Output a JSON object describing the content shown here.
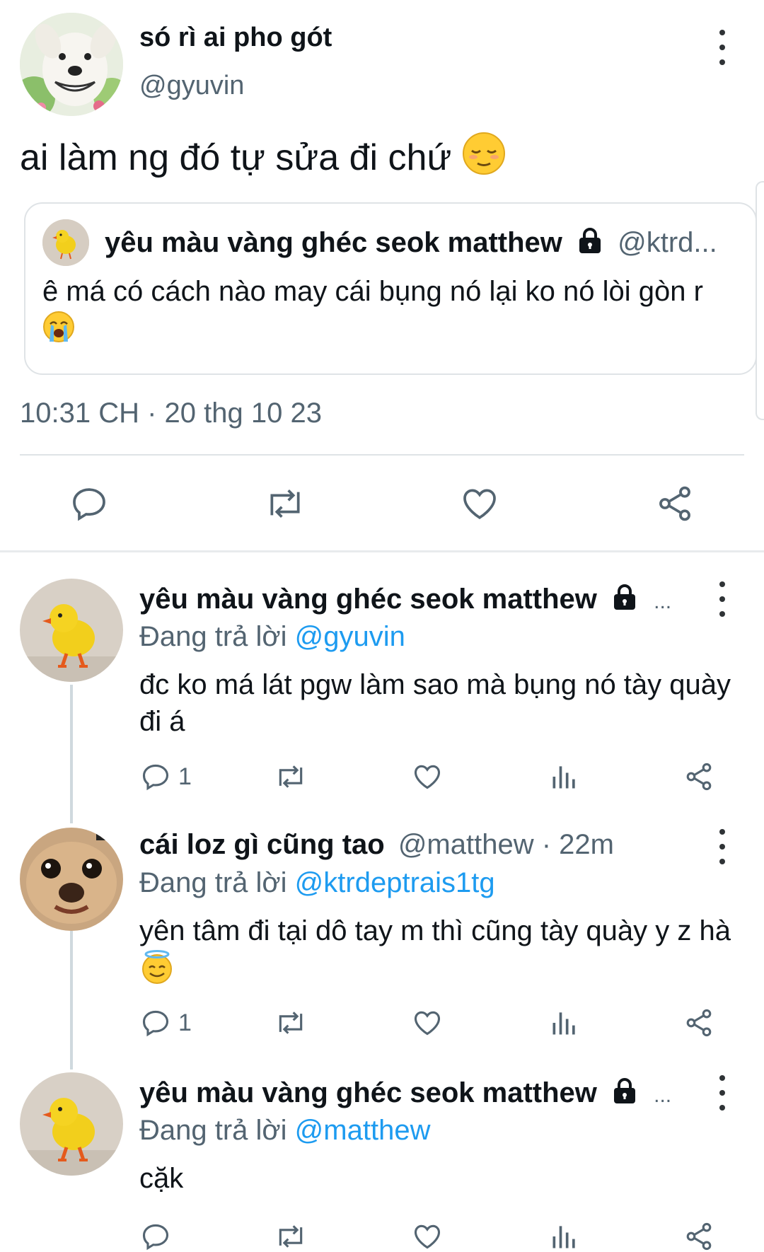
{
  "main_tweet": {
    "display_name": "só rì ai pho gót",
    "handle": "@gyuvin",
    "text": "ai làm ng đó tự sửa đi chứ",
    "text_emoji": "relieved-face",
    "timestamp": "10:31 CH · 20 thg 10 23",
    "avatar": "smiling-dog"
  },
  "quoted_tweet": {
    "display_name": "yêu màu vàng ghéc seok matthew",
    "handle": "@ktrd...",
    "text": "ê má có cách nào may cái bụng nó lại ko nó lòi gòn r",
    "text_emoji": "loudly-crying-face",
    "avatar": "yellow-chick"
  },
  "actions": [
    "reply-icon",
    "retweet-icon",
    "like-icon",
    "share-icon"
  ],
  "replies": [
    {
      "display_name": "yêu màu vàng ghéc seok matthew",
      "name_suffix": "...",
      "replying_prefix": "Đang trả lời",
      "replying_to": "@gyuvin",
      "text": "đc ko má lát pgw làm sao mà bụng nó tày quày đi á",
      "reply_count": "1",
      "avatar": "yellow-chick",
      "locked": true
    },
    {
      "display_name": "cái loz gì cũng tao",
      "handle_time": "@matthew · 22m",
      "replying_prefix": "Đang trả lời",
      "replying_to": "@ktrdeptrais1tg",
      "text": "yên tâm đi tại dô tay m thì cũng tày quày y z hà",
      "text_emoji": "smiling-face-with-halo",
      "reply_count": "1",
      "avatar": "chihuahua"
    },
    {
      "display_name": "yêu màu vàng ghéc seok matthew",
      "name_suffix": "...",
      "replying_prefix": "Đang trả lời",
      "replying_to": "@matthew",
      "text": "cặk",
      "reply_count": "",
      "avatar": "yellow-chick",
      "locked": true
    }
  ],
  "colors": {
    "link": "#1d9bf0",
    "muted": "#536471",
    "divider": "#dfe3e6",
    "text": "#0f1419"
  }
}
